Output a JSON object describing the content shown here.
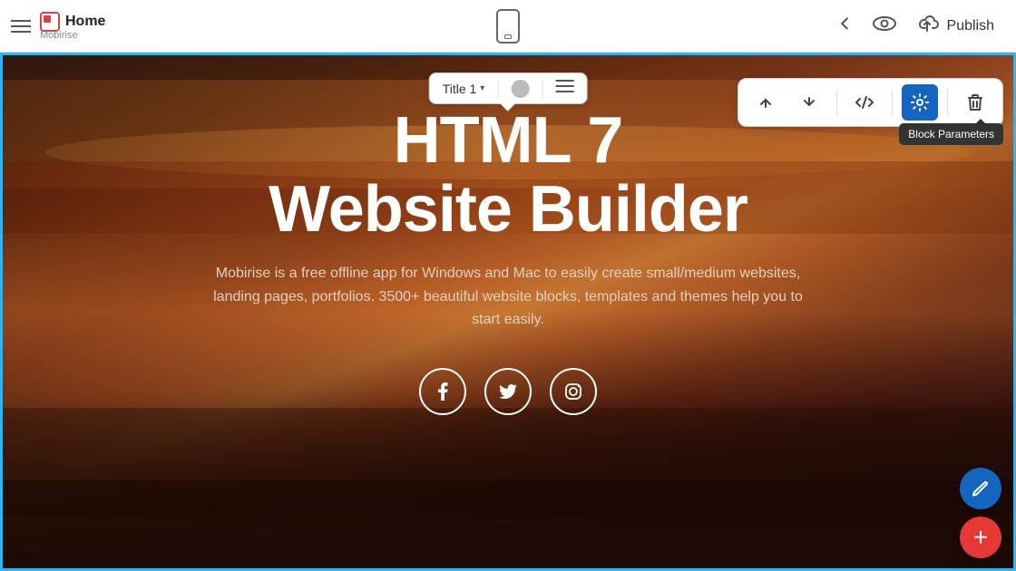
{
  "topbar": {
    "hamburger_label": "menu",
    "logo_text": "Home",
    "logo_sub": "Mobirise",
    "device_label": "mobile preview",
    "back_label": "back",
    "preview_label": "preview",
    "publish_label": "Publish"
  },
  "toolbar": {
    "move_up_label": "move up",
    "move_down_label": "move down",
    "code_label": "code editor",
    "params_label": "block parameters",
    "delete_label": "delete block",
    "block_params_tooltip": "Block Parameters"
  },
  "title_popup": {
    "title": "Title 1",
    "caret": "▾"
  },
  "hero": {
    "title_line1": "HTML 7",
    "title_line2": "Website Builder",
    "description": "Mobirise is a free offline app for Windows and Mac to easily create small/medium websites, landing pages, portfolios. 3500+ beautiful website blocks, templates and themes help you to start easily.",
    "social": {
      "facebook": "f",
      "twitter": "t",
      "instagram": "i"
    }
  },
  "fabs": {
    "edit_label": "edit",
    "add_label": "add block"
  }
}
